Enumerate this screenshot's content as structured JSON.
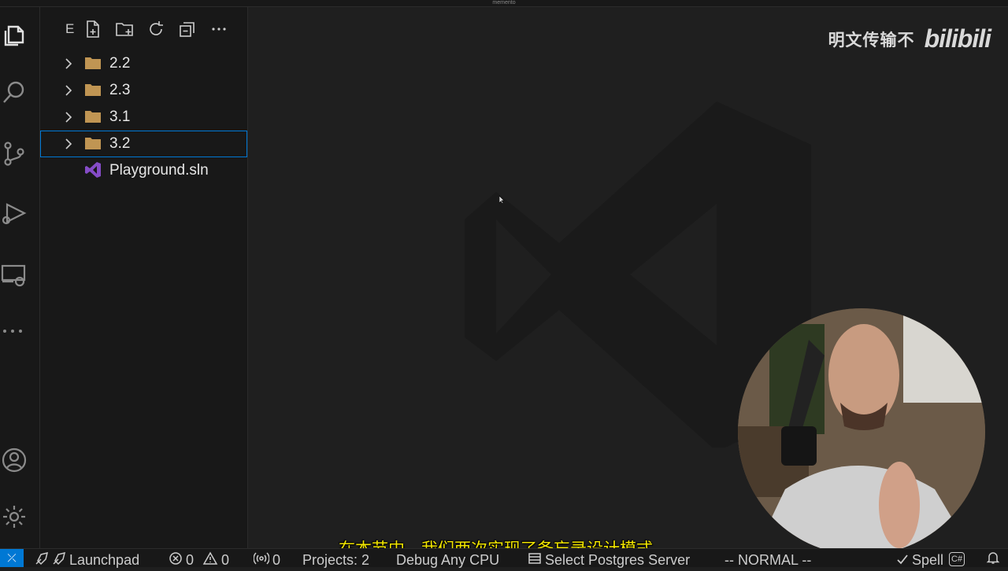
{
  "window": {
    "title": "memento"
  },
  "activity_bar": {
    "items": [
      {
        "name": "explorer-icon"
      },
      {
        "name": "search-icon"
      },
      {
        "name": "source-control-icon"
      },
      {
        "name": "run-debug-icon"
      },
      {
        "name": "remote-explorer-icon"
      },
      {
        "name": "more-icon"
      },
      {
        "name": "account-icon"
      },
      {
        "name": "settings-gear-icon"
      }
    ]
  },
  "explorer": {
    "title_letter": "E",
    "toolbar": [
      "new-file-icon",
      "new-folder-icon",
      "refresh-icon",
      "collapse-all-icon",
      "more-actions-icon"
    ],
    "items": [
      {
        "label": "2.2",
        "type": "folder",
        "selected": false
      },
      {
        "label": "2.3",
        "type": "folder",
        "selected": false
      },
      {
        "label": "3.1",
        "type": "folder",
        "selected": false
      },
      {
        "label": "3.2",
        "type": "folder",
        "selected": true
      },
      {
        "label": "Playground.sln",
        "type": "solution",
        "selected": false
      }
    ]
  },
  "watermark": {
    "text": "明文传输不",
    "logo": "bilibili"
  },
  "subtitle": "在本节中，我们两次实现了备忘录设计模式。",
  "status_bar": {
    "launchpad": "Launchpad",
    "errors": "0",
    "warnings": "0",
    "ports": "0",
    "projects": "Projects: 2",
    "debug": "Debug Any CPU",
    "postgres": "Select Postgres Server",
    "mode": "-- NORMAL --",
    "spell": "Spell",
    "language": "C#"
  },
  "colors": {
    "accent": "#0078d4",
    "folder": "#c09553",
    "sln": "#854cc7",
    "subtitle": "#f2e600"
  }
}
